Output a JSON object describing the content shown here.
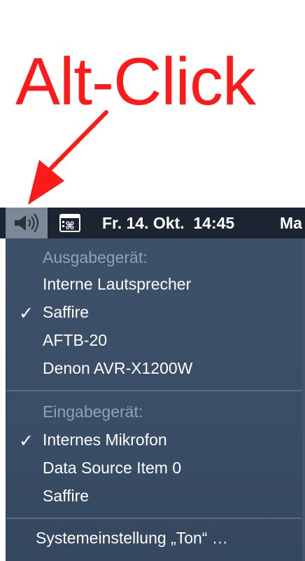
{
  "annotation": {
    "title": "Alt-Click",
    "color": "#ff1a1a"
  },
  "menubar": {
    "sound_icon": "speaker-volume-icon",
    "keyboard_icon": "keyboard-viewer-icon",
    "clock": "Fr. 14. Okt.  14:45",
    "user": "Ma"
  },
  "menu": {
    "output_header": "Ausgabegerät:",
    "output_devices": [
      {
        "label": "Interne Lautsprecher",
        "checked": false
      },
      {
        "label": "Saffire",
        "checked": true
      },
      {
        "label": "AFTB-20",
        "checked": false
      },
      {
        "label": "Denon AVR-X1200W",
        "checked": false
      }
    ],
    "input_header": "Eingabegerät:",
    "input_devices": [
      {
        "label": "Internes Mikrofon",
        "checked": true
      },
      {
        "label": "Data Source Item 0",
        "checked": false
      },
      {
        "label": "Saffire",
        "checked": false
      }
    ],
    "settings_label": "Systemeinstellung „Ton“ …",
    "check_glyph": "✓"
  }
}
